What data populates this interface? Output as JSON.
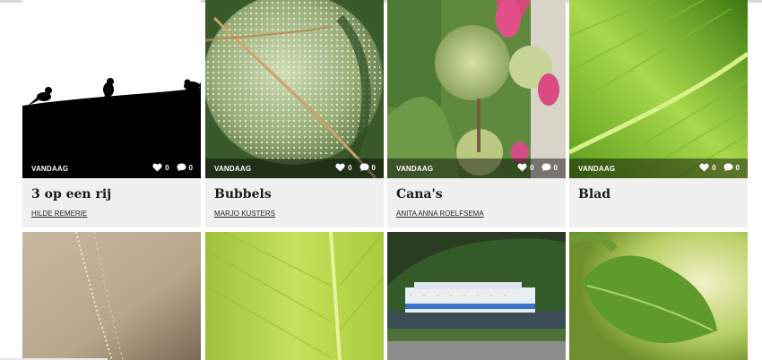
{
  "photos": [
    {
      "title": "3 op een rij",
      "author": "HILDE REMERIE",
      "date": "VANDAAG",
      "likes": "0",
      "comments": "0"
    },
    {
      "title": "Bubbels",
      "author": "MARJO KUSTERS",
      "date": "VANDAAG",
      "likes": "0",
      "comments": "0"
    },
    {
      "title": "Cana's",
      "author": "ANITA ANNA ROELFSEMA",
      "date": "VANDAAG",
      "likes": "0",
      "comments": "0"
    },
    {
      "title": "Blad",
      "author": "",
      "date": "VANDAAG",
      "likes": "0",
      "comments": "0"
    }
  ],
  "icons": {
    "like": "heart-icon",
    "comment": "comment-bubble-icon"
  },
  "colors": {
    "overlay": "#00000073",
    "info_background": "#f0f0f0",
    "title": "#1a1a1a"
  }
}
